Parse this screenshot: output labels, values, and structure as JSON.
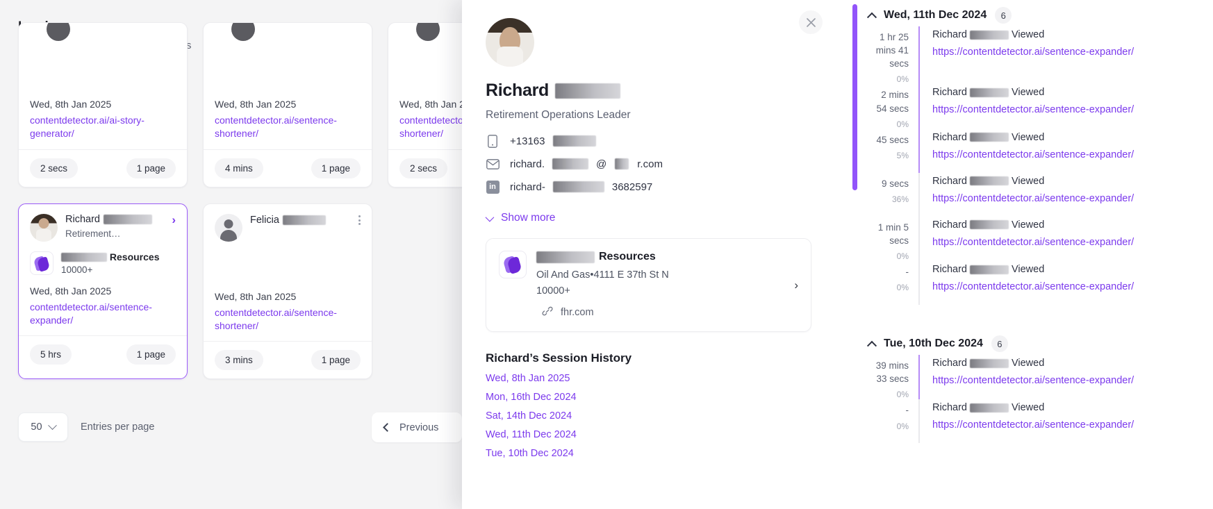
{
  "page": {
    "title": "Leads",
    "subtitle": "Your website visitor profile and insights"
  },
  "cards": [
    {
      "name": "",
      "role": "",
      "company": "",
      "company_size": "",
      "date": "Wed, 8th Jan 2025",
      "url": "contentdetector.ai/ai-story-generator/",
      "duration": "2 secs",
      "pages": "1 page",
      "selected": false,
      "avatar": "blank-scrolled",
      "menu": "kebab-icon"
    },
    {
      "name": "",
      "role": "",
      "company": "",
      "company_size": "",
      "date": "Wed, 8th Jan 2025",
      "url": "contentdetector.ai/sentence-shortener/",
      "duration": "4 mins",
      "pages": "1 page",
      "selected": false,
      "avatar": "blank-scrolled",
      "menu": "kebab-icon"
    },
    {
      "name": "",
      "role": "",
      "company": "",
      "company_size": "",
      "date": "Wed, 8th Jan 2025",
      "url": "contentdetector.ai/sentence-shortener/",
      "duration": "2 secs",
      "pages": "1 page",
      "selected": false,
      "avatar": "blank-scrolled",
      "menu": "kebab-icon"
    },
    {
      "name": "Richard",
      "role": "Retirement…",
      "company": "Resources",
      "company_size": "10000+",
      "date": "Wed, 8th Jan 2025",
      "url": "contentdetector.ai/sentence-expander/",
      "duration": "5 hrs",
      "pages": "1 page",
      "selected": true,
      "avatar": "photo",
      "menu": "chevron-right-icon"
    },
    {
      "name": "Felicia",
      "role": "",
      "company": "",
      "company_size": "",
      "date": "Wed, 8th Jan 2025",
      "url": "contentdetector.ai/sentence-shortener/",
      "duration": "3 mins",
      "pages": "1 page",
      "selected": false,
      "avatar": "placeholder",
      "menu": "kebab-icon"
    }
  ],
  "pagination": {
    "per_page_value": "50",
    "per_page_label": "Entries per page",
    "prev_label": "Previous"
  },
  "profile": {
    "close_icon": "close-icon",
    "name": "Richard",
    "role": "Retirement Operations Leader",
    "phone": "+13163",
    "email_prefix": "richard.",
    "email_suffix": "r.com",
    "linkedin_prefix": "richard-",
    "linkedin_suffix": "3682597",
    "show_more_label": "Show more",
    "company": {
      "name": "Resources",
      "industry_address": "Oil And Gas•4111 E 37th St N",
      "size": "10000+",
      "website": "fhr.com"
    },
    "session_history_title": "Richard’s Session History",
    "sessions": [
      "Wed, 8th Jan 2025",
      "Mon, 16th Dec 2024",
      "Sat, 14th Dec 2024",
      "Wed, 11th Dec 2024",
      "Tue, 10th Dec 2024"
    ]
  },
  "timeline": {
    "groups": [
      {
        "date": "Wed, 11th Dec 2024",
        "count": "6",
        "events": [
          {
            "duration": "1 hr 25 mins 41 secs",
            "percent": "0%",
            "who": "Richard",
            "action": "Viewed",
            "url": "https://contentdetector.ai/sentence-expander/",
            "active": true
          },
          {
            "duration": "2 mins 54 secs",
            "percent": "0%",
            "who": "Richard",
            "action": "Viewed",
            "url": "https://contentdetector.ai/sentence-expander/",
            "active": true
          },
          {
            "duration": "45 secs",
            "percent": "5%",
            "who": "Richard",
            "action": "Viewed",
            "url": "https://contentdetector.ai/sentence-expander/",
            "active": true
          },
          {
            "duration": "9 secs",
            "percent": "36%",
            "who": "Richard",
            "action": "Viewed",
            "url": "https://contentdetector.ai/sentence-expander/",
            "active": false
          },
          {
            "duration": "1 min 5 secs",
            "percent": "0%",
            "who": "Richard",
            "action": "Viewed",
            "url": "https://contentdetector.ai/sentence-expander/",
            "active": false
          },
          {
            "duration": "-",
            "percent": "0%",
            "who": "Richard",
            "action": "Viewed",
            "url": "https://contentdetector.ai/sentence-expander/",
            "active": false
          }
        ]
      },
      {
        "date": "Tue, 10th Dec 2024",
        "count": "6",
        "events": [
          {
            "duration": "39 mins 33 secs",
            "percent": "0%",
            "who": "Richard",
            "action": "Viewed",
            "url": "https://contentdetector.ai/sentence-expander/",
            "active": true
          },
          {
            "duration": "-",
            "percent": "0%",
            "who": "Richard",
            "action": "Viewed",
            "url": "https://contentdetector.ai/sentence-expander/",
            "active": false
          }
        ]
      }
    ]
  },
  "colors": {
    "accent": "#7c3aed",
    "scrollbar": "#9254fa",
    "page_bg": "#f4f4f5"
  }
}
